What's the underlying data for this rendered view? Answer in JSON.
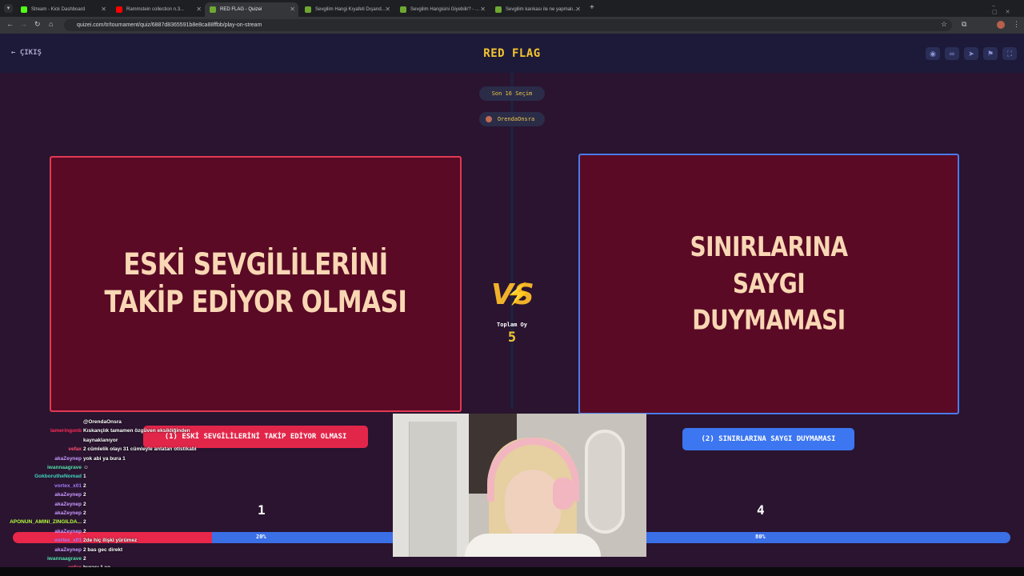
{
  "browser": {
    "tabs": [
      {
        "title": "Stream - Kick Dashboard",
        "favicon_color": "#53fc18",
        "active": false
      },
      {
        "title": "Rammstein collection n.3...",
        "favicon_color": "#ff0000",
        "active": false
      },
      {
        "title": "RED FLAG - Quizei",
        "favicon_color": "#6ea832",
        "active": true
      },
      {
        "title": "Sevgilim Hangi Kıyafeti Dışarıd...",
        "favicon_color": "#6ea832",
        "active": false
      },
      {
        "title": "Sevgilim Hangisini Giyebilir? - ...",
        "favicon_color": "#6ea832",
        "active": false
      },
      {
        "title": "Sevgilim karıkası ile ne yapmalı...",
        "favicon_color": "#6ea832",
        "active": false
      }
    ],
    "new_tab": "+",
    "url": "quizei.com/tr/tournament/quiz/6887d8365591b8e8ca88ffbb/play-on-stream"
  },
  "header": {
    "exit_label": "← ÇIKIŞ",
    "title": "RED FLAG",
    "icons": [
      "eye-icon",
      "link-icon",
      "send-icon",
      "flag-icon",
      "fullscreen-icon"
    ]
  },
  "stage": {
    "round_label": "Son 16 Seçim",
    "host_name": "OrendaOnsra",
    "left_option": {
      "text": "ESKİ SEVGİLİLERİNİ\nTAKİP EDİYOR OLMASI",
      "vote_label": "(1) ESKİ SEVGİLİLERİNİ TAKİP EDİYOR OLMASI",
      "count": "1",
      "percent_label": "20%",
      "share": 0.2,
      "color": "#e8274b"
    },
    "right_option": {
      "text": "SINIRLARINA\nSAYGI\nDUYMAMASI",
      "vote_label": "(2) SINIRLARINA SAYGI DUYMAMASI",
      "count": "4",
      "percent_label": "80%",
      "share": 0.8,
      "color": "#3a6fe6"
    },
    "vs_label": "VS",
    "total_label": "Toplam Oy",
    "total_value": "5"
  },
  "chat": [
    {
      "user": "",
      "msg": "@OrendaOnsra",
      "color": "#ffffff"
    },
    {
      "user": "lameringonb",
      "msg": "Kıskançlık tamamen özgüven eksikliğinden",
      "color": "#ff2a55"
    },
    {
      "user": "",
      "msg": "kaynaklanıyor",
      "color": "#ffffff"
    },
    {
      "user": "vefax",
      "msg": "2 cümlelik olayı 31 cümleyle anlatan otistikabi",
      "color": "#ff4f6e"
    },
    {
      "user": "akaZeynep",
      "msg": "yok abi ya bura 1",
      "color": "#c89bff"
    },
    {
      "user": "iwannaagrave",
      "msg": "☺",
      "color": "#4fe0a8"
    },
    {
      "user": "GokborutheNomad",
      "msg": "1",
      "color": "#3ed6c2"
    },
    {
      "user": "vortex_x01",
      "msg": "2",
      "color": "#a27cff"
    },
    {
      "user": "akaZeynep",
      "msg": "2",
      "color": "#c89bff"
    },
    {
      "user": "akaZeynep",
      "msg": "2",
      "color": "#c89bff"
    },
    {
      "user": "akaZeynep",
      "msg": "2",
      "color": "#c89bff"
    },
    {
      "user": "APONUN_AMINI_ZINGILDA...",
      "msg": "2",
      "color": "#b4ff3c"
    },
    {
      "user": "akaZeynep",
      "msg": "2",
      "color": "#c89bff"
    },
    {
      "user": "vortex_x01",
      "msg": "2de hiç ilişki yürümez",
      "color": "#a27cff"
    },
    {
      "user": "akaZeynep",
      "msg": "2 bas gec direkt",
      "color": "#c89bff"
    },
    {
      "user": "iwannaagrave",
      "msg": "2",
      "color": "#4fe0a8"
    },
    {
      "user": "vefax",
      "msg": "burası 1 ya",
      "color": "#ff4f6e"
    }
  ],
  "colors": {
    "accent_yellow": "#f4c531",
    "red": "#e8274b",
    "blue": "#3a6fe6",
    "card_bg": "#5a0a25"
  }
}
